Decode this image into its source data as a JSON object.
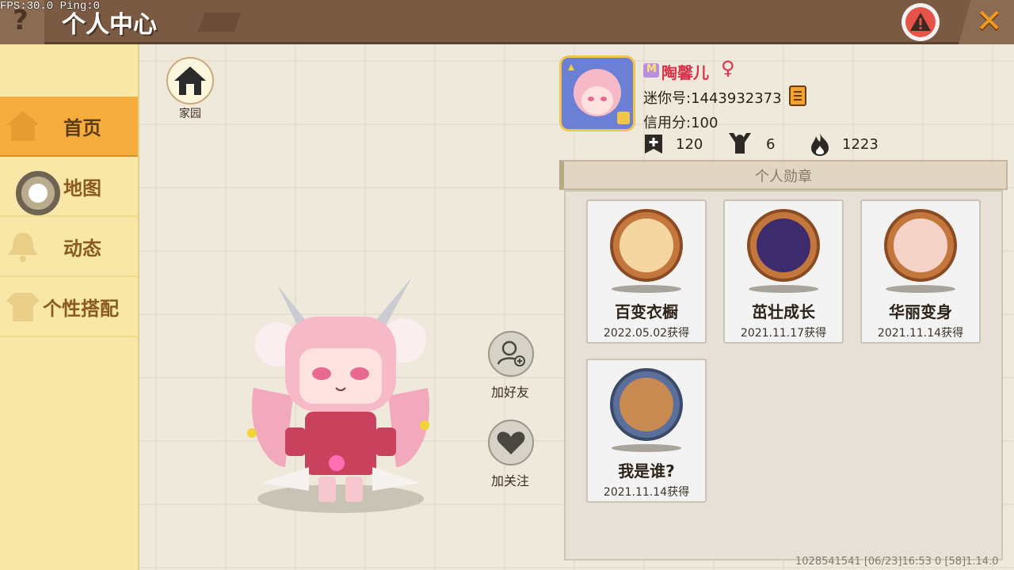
{
  "debug": {
    "fps_text": "FPS:30.0  Ping:0"
  },
  "header": {
    "help_icon": "question-icon",
    "title": "个人中心",
    "report_icon": "warning-icon",
    "close_icon": "close-icon"
  },
  "sidebar": {
    "items": [
      {
        "label": "首页",
        "active": true
      },
      {
        "label": "地图",
        "active": false
      },
      {
        "label": "动态",
        "active": false
      },
      {
        "label": "个性搭配",
        "active": false
      }
    ]
  },
  "home": {
    "label": "家园"
  },
  "actions": {
    "add_friend": "加好友",
    "follow": "加关注"
  },
  "profile": {
    "name": "陶馨儿",
    "gender_symbol": "♀",
    "mini_id": "迷你号:1443932373",
    "credit": "信用分:100",
    "stats": [
      {
        "icon": "plus-flag-icon",
        "value": "120"
      },
      {
        "icon": "cheer-person-icon",
        "value": "6"
      },
      {
        "icon": "flame-icon",
        "value": "1223"
      }
    ]
  },
  "medals": {
    "title": "个人勋章",
    "items": [
      {
        "name": "百变衣橱",
        "date": "2022.05.02获得"
      },
      {
        "name": "茁壮成长",
        "date": "2021.11.17获得"
      },
      {
        "name": "华丽变身",
        "date": "2021.11.14获得"
      },
      {
        "name": "我是谁?",
        "date": "2021.11.14获得"
      }
    ]
  },
  "footer": {
    "text": "1028541541   [06/23]16:53 0  [58]1.14.0"
  },
  "colors": {
    "header": "#7b5a43",
    "sidebar": "#f9e7a8",
    "sidebar_active": "#f5ae3e",
    "name_red": "#d9334a",
    "close_orange": "#f19a1e"
  }
}
